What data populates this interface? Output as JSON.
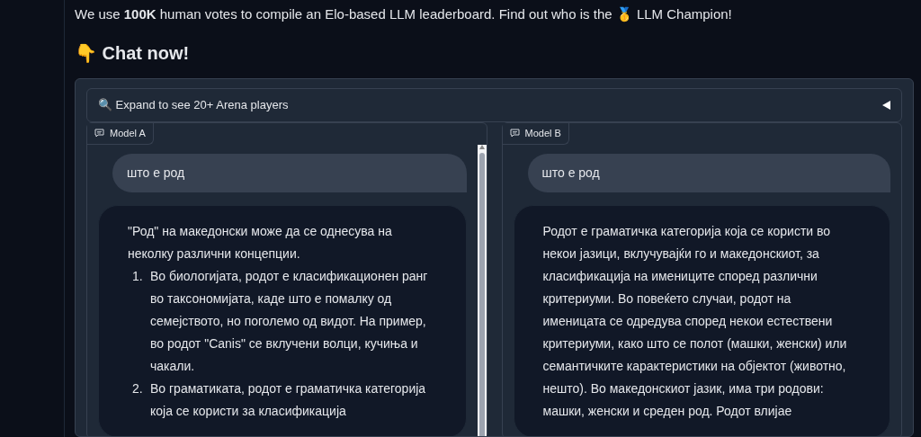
{
  "intro": "We use **100K** human votes to compile an Elo-based LLM leaderboard. Find out who is the 🥇 LLM Champion!",
  "heading": "👇 Chat now!",
  "accordion": {
    "label": "🔍 Expand to see 20+ Arena players",
    "expanded": false
  },
  "chats": [
    {
      "label": "Model A",
      "user": "што е род",
      "reply": {
        "intro": "\"Род\" на македонски може да се однесува на неколку различни концепции.",
        "items": [
          {
            "number": "1.",
            "text": "Во биологијата, родот е класификационен ранг во таксономијата, каде што е помалку од семејството, но поголемо од видот. На пример, во родот \"Canis\" се вклучени волци, кучиња и чакали."
          },
          {
            "number": "2.",
            "text": "Во граматиката, родот е граматичка категорија која се користи за класификација"
          }
        ]
      },
      "scrollbar": true
    },
    {
      "label": "Model B",
      "user": "што е род",
      "reply": {
        "intro": "Родот е граматичка категорија која се користи во некои јазици, вклучувајќи го и македонскиот, за класификација на имениците според различни критериуми. Во повеќето случаи, родот на именицата се одредува според некои естествени критериуми, како што се полот (машки, женски) или семантичките карактеристики на објектот (животно, нешто). Во македонскиот јазик, има три родови: машки, женски и среден род. Родот влијае"
      },
      "scrollbar": false
    }
  ]
}
